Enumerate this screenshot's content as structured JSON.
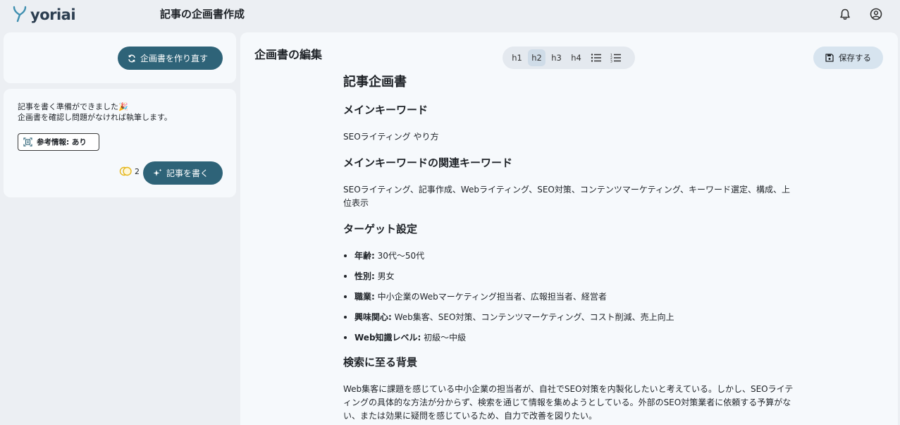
{
  "app": {
    "logo_text": "yoriai",
    "page_title": "記事の企画書作成"
  },
  "header_icons": [
    "bell-icon",
    "account-circle-icon"
  ],
  "left": {
    "regenerate_label": "企画書を作り直す",
    "ready_line1": "記事を書く準備ができました🎉",
    "ready_line2": "企画書を確認し問題がなければ執筆します。",
    "reference_label": "参考情報: あり",
    "credits": "2",
    "write_label": "記事を書く"
  },
  "editor": {
    "title": "企画書の編集",
    "toolbar": [
      "h1",
      "h2",
      "h3",
      "h4"
    ],
    "active_heading": "h2",
    "save_label": "保存する"
  },
  "doc": {
    "h1": "記事企画書",
    "s1_heading": "メインキーワード",
    "s1_text": "SEOライティング やり方",
    "s2_heading": "メインキーワードの関連キーワード",
    "s2_text": "SEOライティング、記事作成、Webライティング、SEO対策、コンテンツマーケティング、キーワード選定、構成、上位表示",
    "s3_heading": "ターゲット設定",
    "targets": [
      {
        "label": "年齢:",
        "value": "30代〜50代"
      },
      {
        "label": "性別:",
        "value": "男女"
      },
      {
        "label": "職業:",
        "value": "中小企業のWebマーケティング担当者、広報担当者、経営者"
      },
      {
        "label": "興味関心:",
        "value": "Web集客、SEO対策、コンテンツマーケティング、コスト削減、売上向上"
      },
      {
        "label": "Web知識レベル:",
        "value": "初級〜中級"
      }
    ],
    "s4_heading": "検索に至る背景",
    "s4_text": "Web集客に課題を感じている中小企業の担当者が、自社でSEO対策を内製化したいと考えている。しかし、SEOライティングの具体的な方法が分からず、検索を通じて情報を集めようとしている。外部のSEO対策業者に依頼する予算がない、または効果に疑問を感じているため、自力で改善を図りたい。"
  },
  "colors": {
    "primary": "#2e6378",
    "background": "#eceff3",
    "card": "#f6f9fc",
    "toolbar": "#e4e9ef",
    "save": "#d7e4ef",
    "logo_accent": "#3f8fb0"
  }
}
